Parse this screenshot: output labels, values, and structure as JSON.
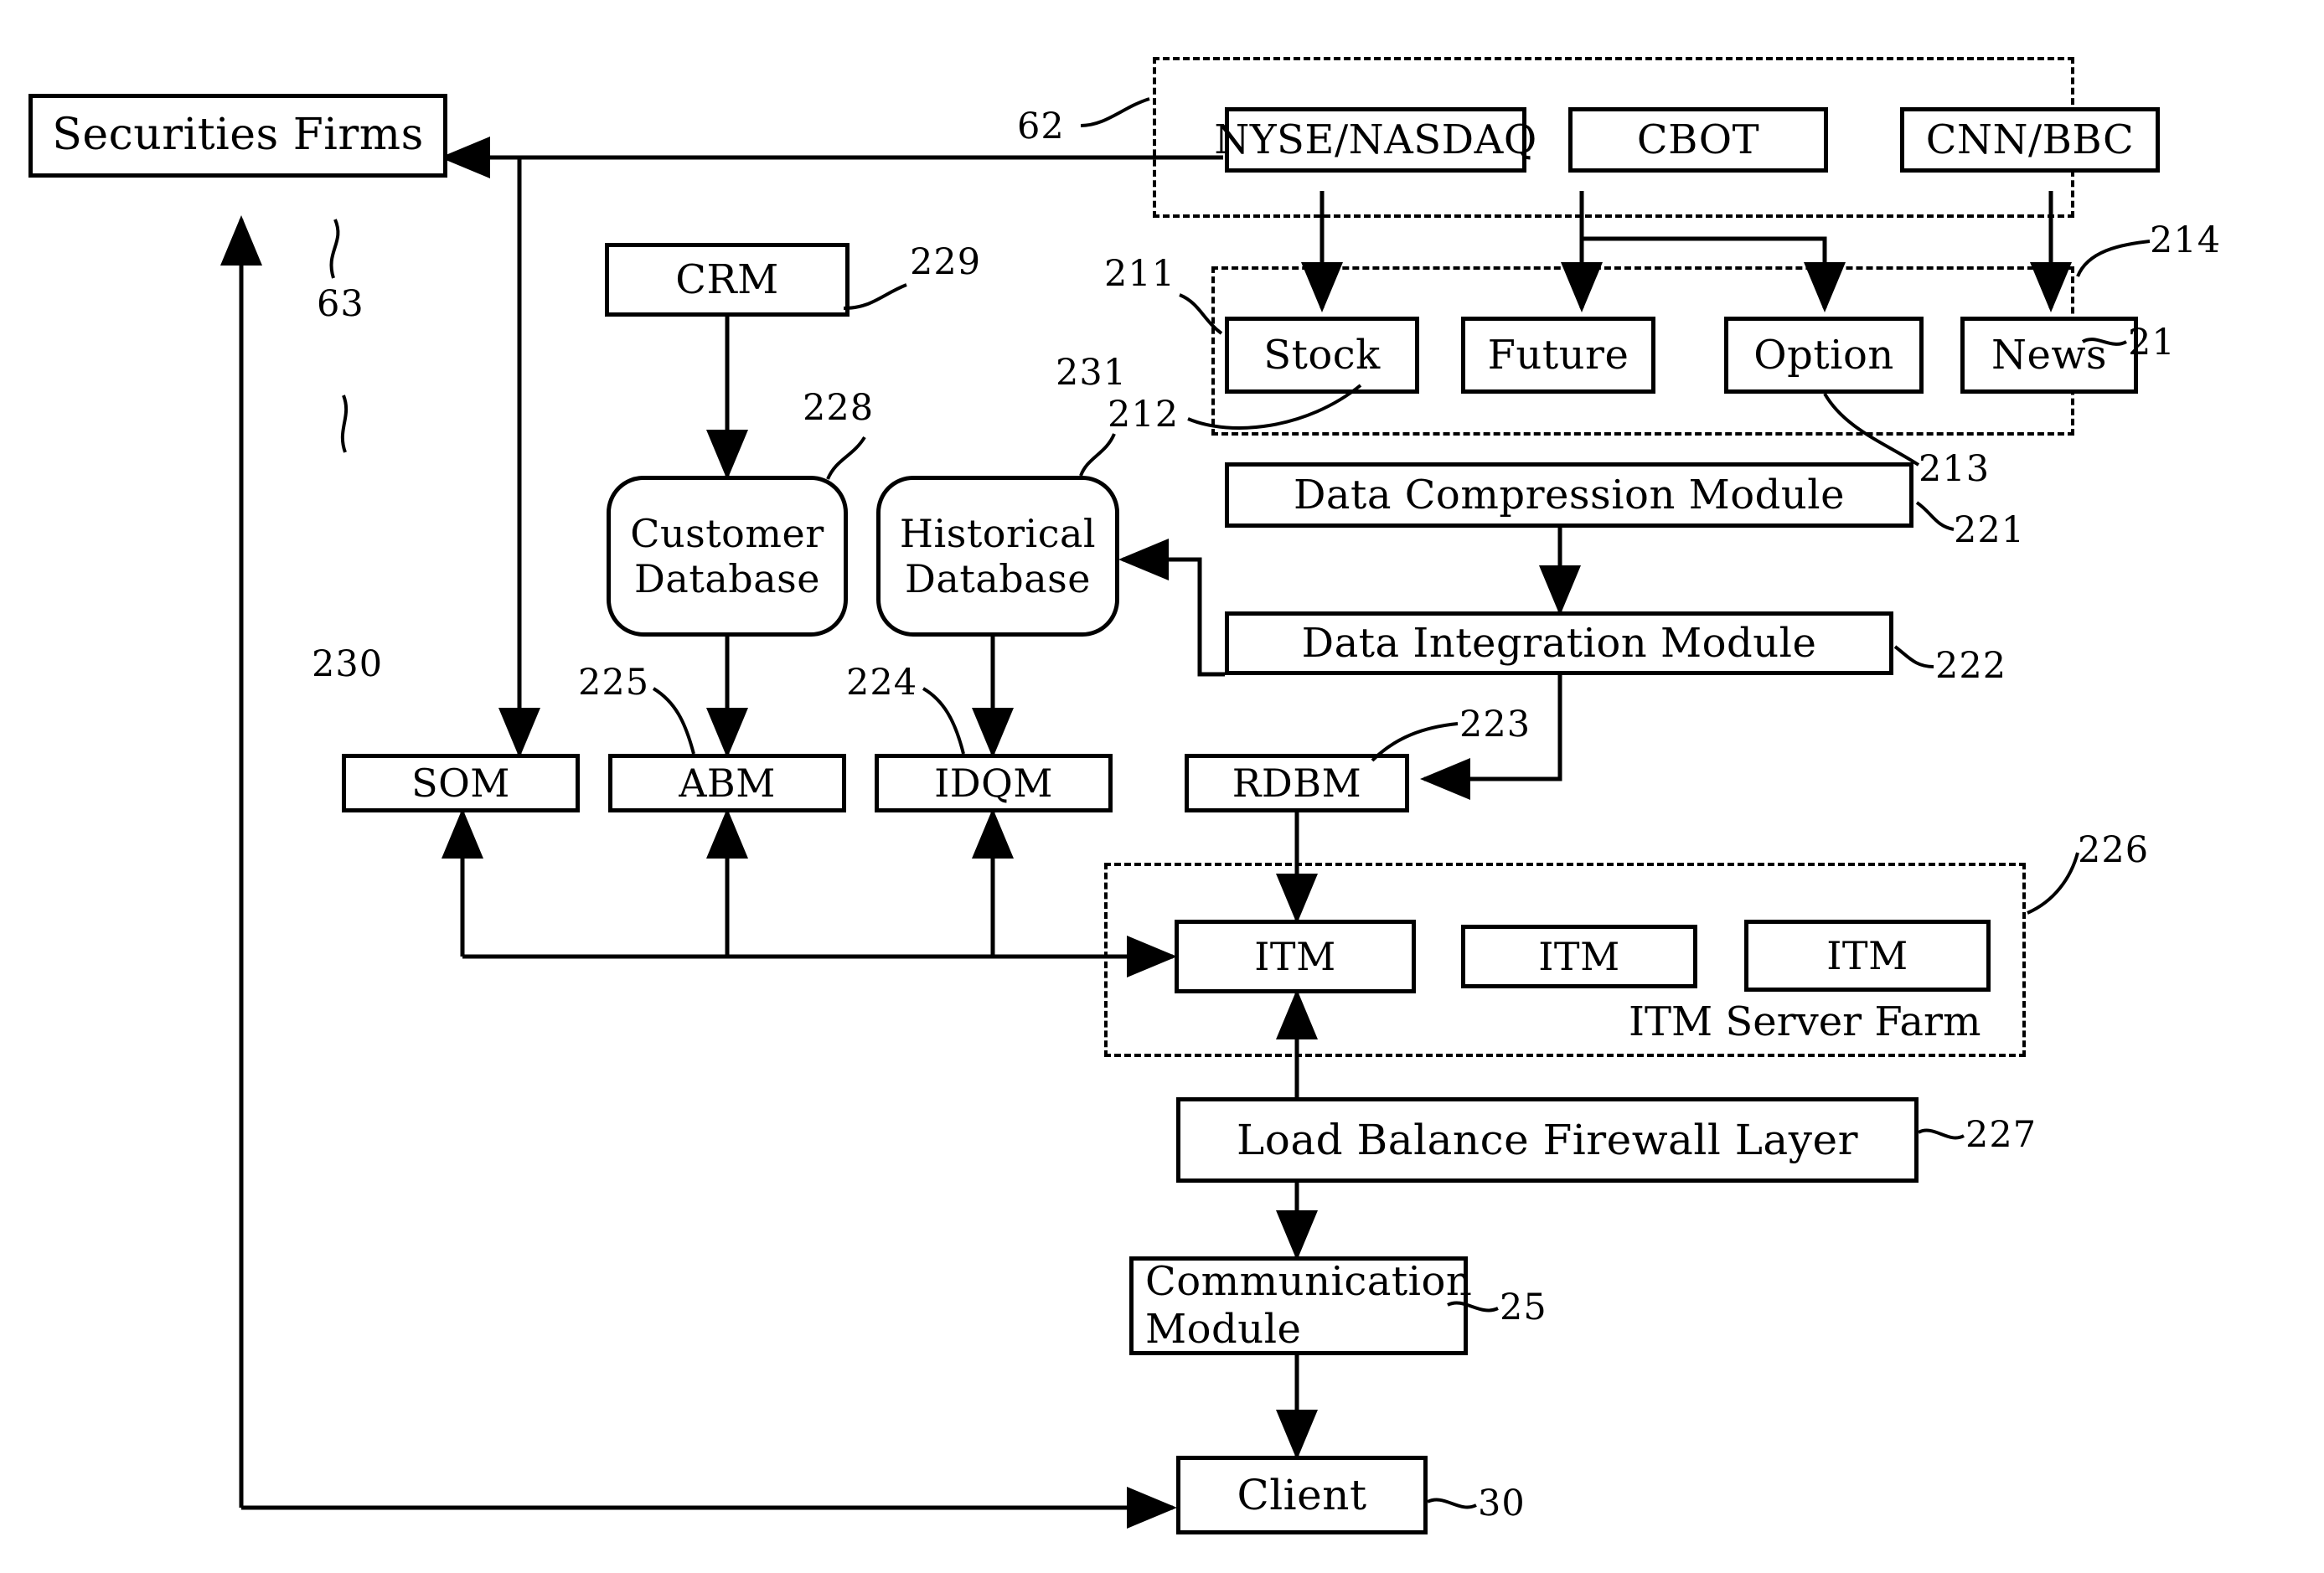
{
  "diagram": {
    "title": "Securities information distribution system architecture",
    "ink_color": "#000000",
    "background": "#ffffff"
  },
  "nodes": {
    "securities_firms": "Securities Firms",
    "nyse_nasdaq": "NYSE/NASDAQ",
    "cbot": "CBOT",
    "cnn_bbc": "CNN/BBC",
    "stock": "Stock",
    "future": "Future",
    "option": "Option",
    "news": "News",
    "crm": "CRM",
    "customer_database_line1": "Customer",
    "customer_database_line2": "Database",
    "historical_database_line1": "Historical",
    "historical_database_line2": "Database",
    "data_compression_module": "Data Compression Module",
    "data_integration_module": "Data Integration Module",
    "som": "SOM",
    "abm": "ABM",
    "idqm": "IDQM",
    "rdbm": "RDBM",
    "itm_1": "ITM",
    "itm_2": "ITM",
    "itm_3": "ITM",
    "itm_server_farm": "ITM Server Farm",
    "load_balance_firewall_layer": "Load Balance Firewall Layer",
    "communication_module_line1": "Communication",
    "communication_module_line2": "Module",
    "client": "Client"
  },
  "reference_numerals": {
    "n62": "62",
    "n63": "63",
    "n21": "21",
    "n211": "211",
    "n212": "212",
    "n213": "213",
    "n214": "214",
    "n221": "221",
    "n222": "222",
    "n223": "223",
    "n224": "224",
    "n225": "225",
    "n226": "226",
    "n227": "227",
    "n228": "228",
    "n229": "229",
    "n230": "230",
    "n231": "231",
    "n25": "25",
    "n30": "30"
  }
}
